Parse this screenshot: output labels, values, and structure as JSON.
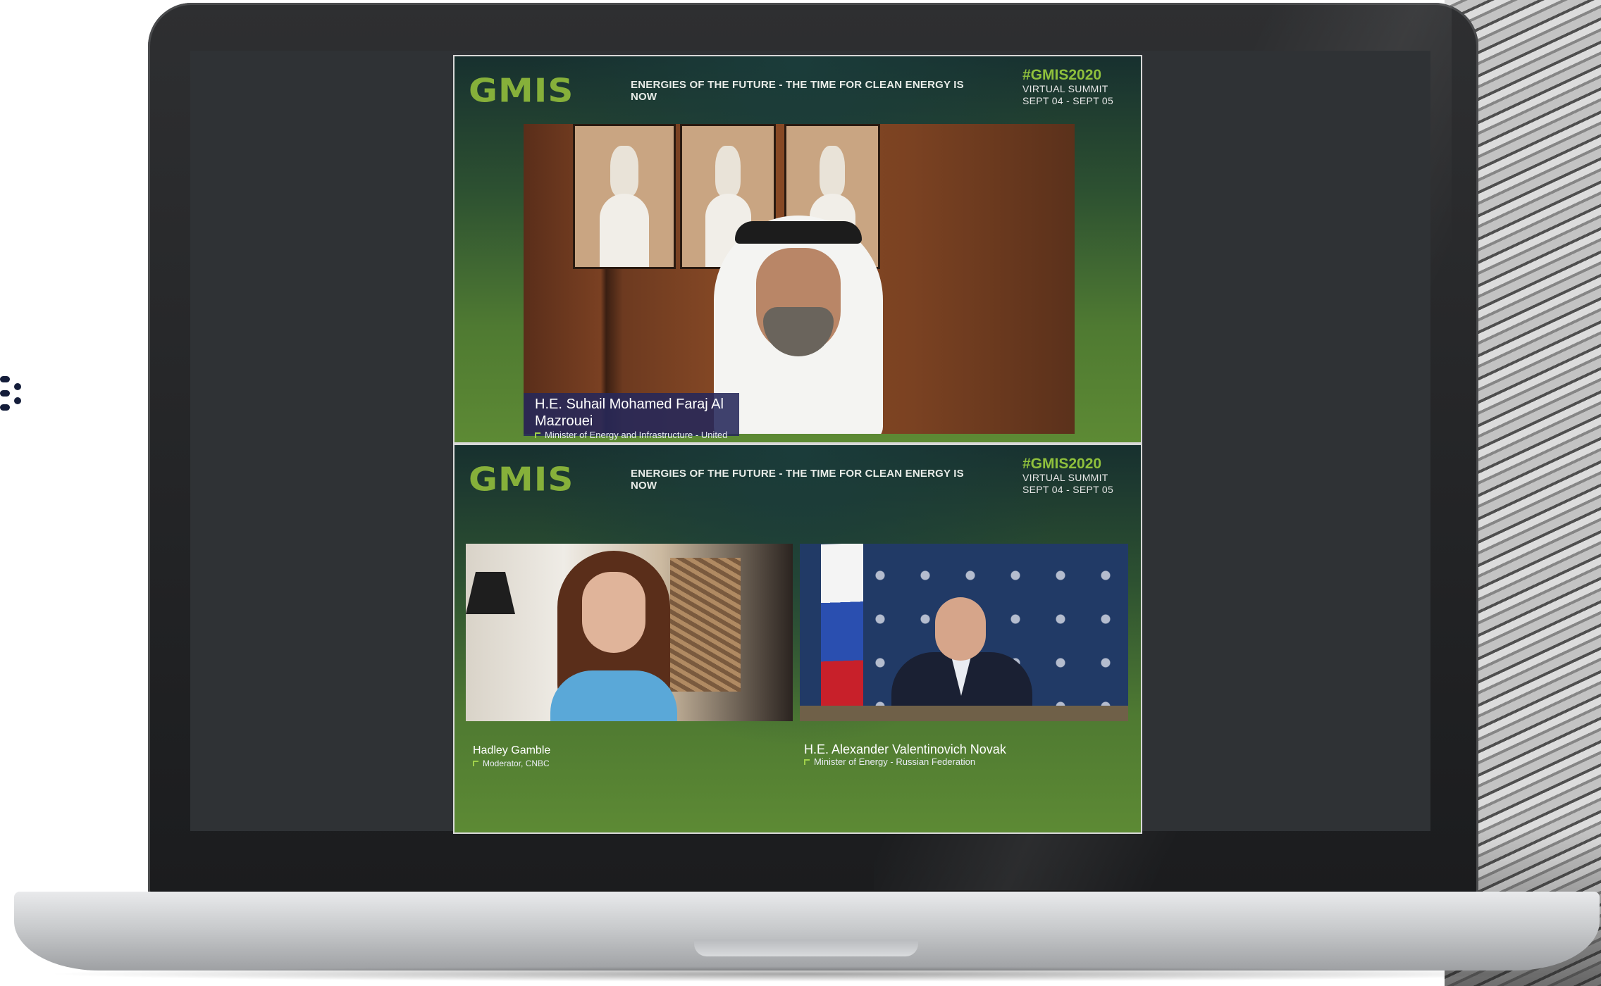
{
  "panels": [
    {
      "logo": "GMIS",
      "tagline": "ENERGIES OF THE FUTURE - THE TIME FOR CLEAN ENERGY IS NOW",
      "hashtag": "#GMIS2020",
      "event_type": "VIRTUAL SUMMIT",
      "dates": "SEPT 04 - SEPT 05",
      "speakers": [
        {
          "name": "H.E. Suhail Mohamed Faraj Al Mazrouei",
          "role": "Minister of Energy and Infrastructure - United Arab Emirates"
        }
      ]
    },
    {
      "logo": "GMIS",
      "tagline": "ENERGIES OF THE FUTURE - THE TIME FOR CLEAN ENERGY IS NOW",
      "hashtag": "#GMIS2020",
      "event_type": "VIRTUAL SUMMIT",
      "dates": "SEPT 04 - SEPT 05",
      "speakers": [
        {
          "name": "Hadley Gamble",
          "role": "Moderator, CNBC"
        },
        {
          "name": "H.E. Alexander Valentinovich Novak",
          "role": "Minister of Energy - Russian Federation"
        }
      ]
    }
  ],
  "colors": {
    "brand_green": "#86b03a",
    "hashtag_green": "#8fc03c",
    "lower_third_bg": "#26285a",
    "screen_bg": "#2f3235"
  }
}
